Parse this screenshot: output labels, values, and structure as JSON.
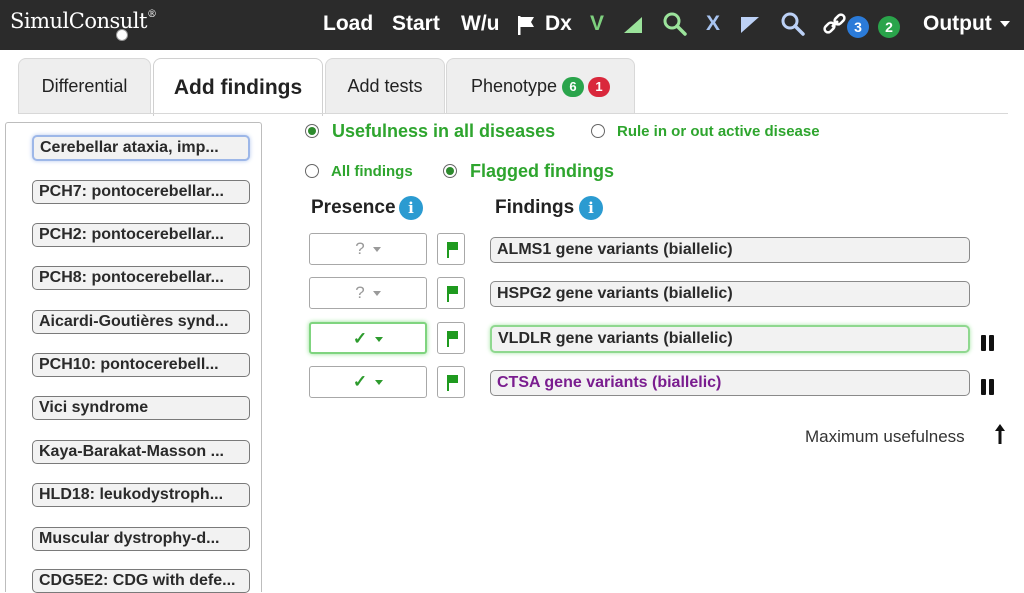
{
  "app": {
    "logo": "SimulConsult",
    "logo_mark": "®"
  },
  "topnav": {
    "load": "Load",
    "start": "Start",
    "wu": "W/u",
    "dx": "Dx",
    "v": "V",
    "x": "X",
    "badge_blue": "3",
    "badge_green": "2",
    "output": "Output"
  },
  "tabs": [
    {
      "label": "Differential"
    },
    {
      "label": "Add findings"
    },
    {
      "label": "Add tests"
    },
    {
      "label": "Phenotype",
      "badge_green": "6",
      "badge_red": "1"
    }
  ],
  "diagnoses": [
    "Cerebellar ataxia, imp...",
    "PCH7: pontocerebellar...",
    "PCH2: pontocerebellar...",
    "PCH8: pontocerebellar...",
    "Aicardi-Goutières synd...",
    "PCH10: pontocerebell...",
    "Vici syndrome",
    "Kaya-Barakat-Masson ...",
    "HLD18: leukodystroph...",
    "Muscular dystrophy-d...",
    "CDG5E2: CDG with defe..."
  ],
  "options": {
    "usefulness_all": "Usefulness in all diseases",
    "rule_in_out": "Rule in or out active disease",
    "all_findings": "All findings",
    "flagged_findings": "Flagged findings"
  },
  "headers": {
    "presence": "Presence",
    "findings": "Findings",
    "info_glyph": "i"
  },
  "findings": [
    {
      "presence": "?",
      "name": "ALMS1 gene variants (biallelic)"
    },
    {
      "presence": "?",
      "name": "HSPG2 gene variants (biallelic)"
    },
    {
      "presence": "✓",
      "name": "VLDLR gene variants (biallelic)"
    },
    {
      "presence": "✓",
      "name": "CTSA gene variants (biallelic)"
    }
  ],
  "footer": {
    "max_usefulness": "Maximum usefulness"
  },
  "colors": {
    "topbar": "#2b2b2b",
    "accent_green": "#2ea52e",
    "badge_blue": "#2b7bd9",
    "badge_green": "#2aa44b",
    "badge_red": "#d9283c",
    "purple_text": "#7a1d8f"
  }
}
